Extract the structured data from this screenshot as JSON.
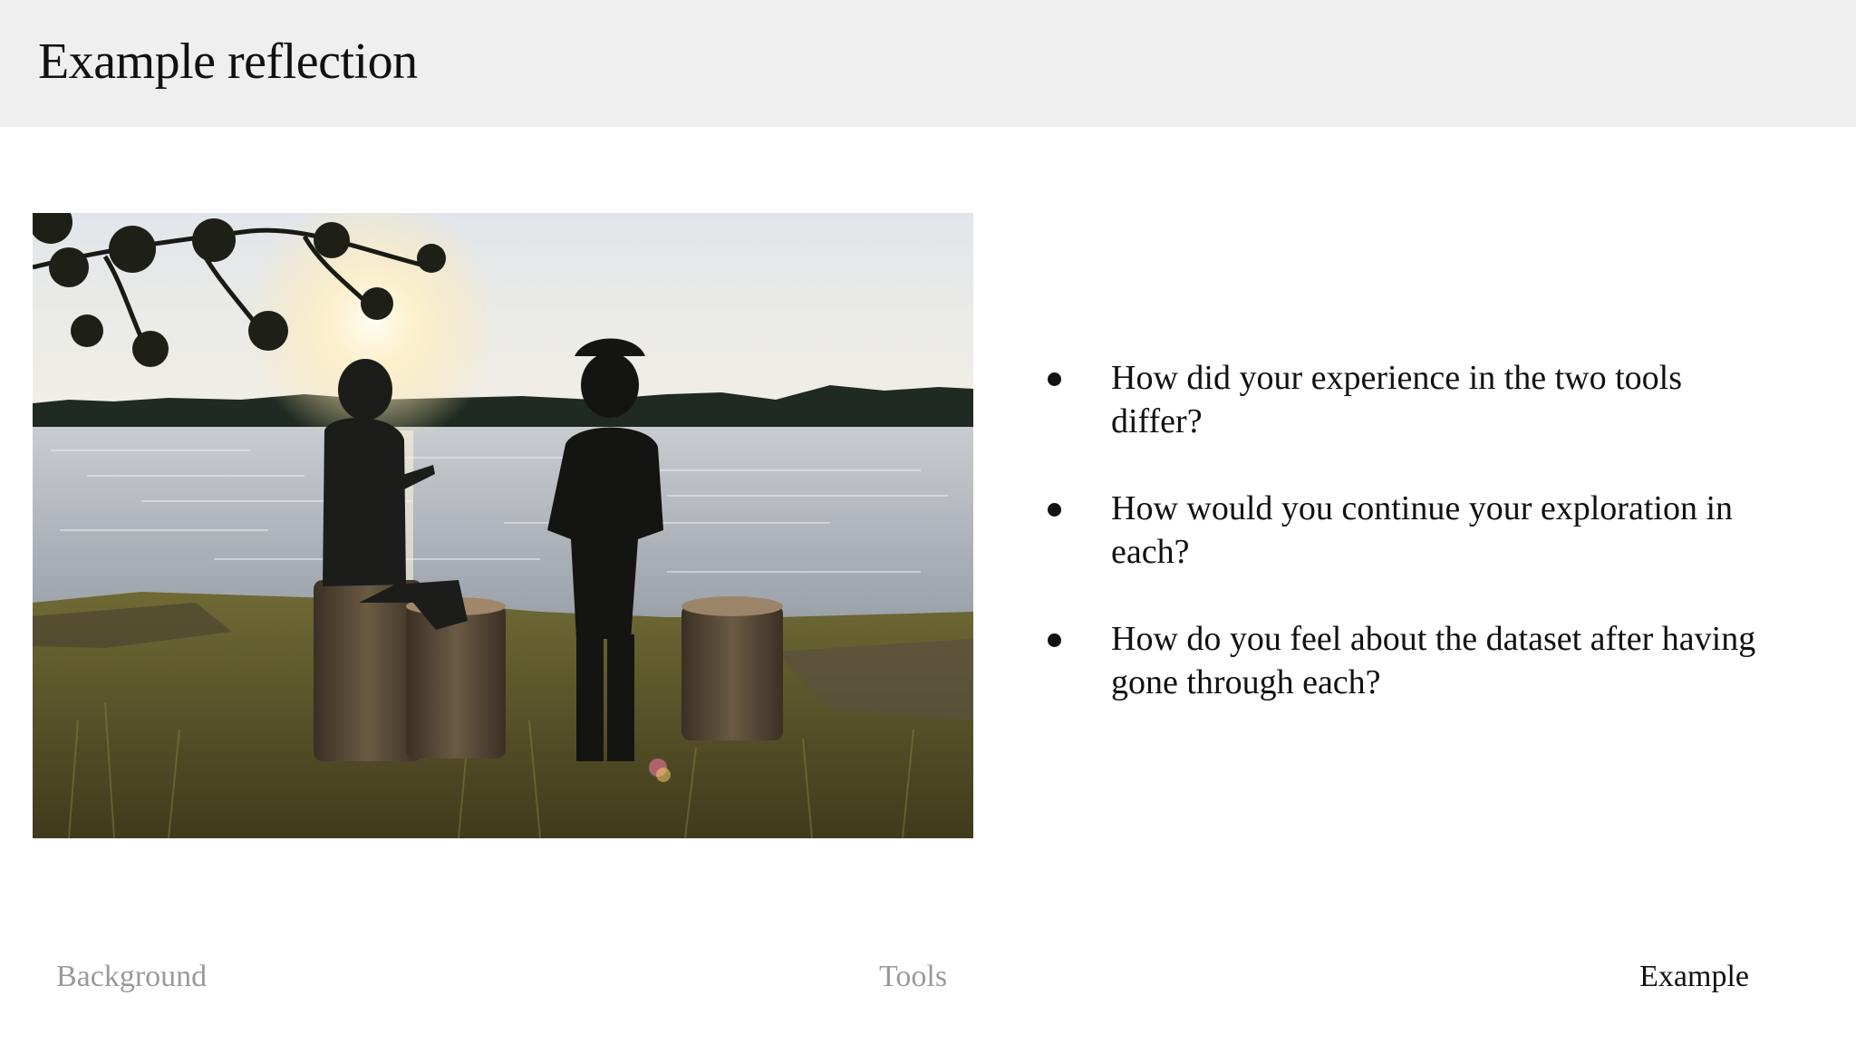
{
  "header": {
    "title": "Example reflection"
  },
  "image": {
    "subject": "two-people-by-lake-photo"
  },
  "bullets": [
    {
      "text": "How did your experience in the two tools differ?"
    },
    {
      "text": "How would you continue your exploration in each?"
    },
    {
      "text": "How do you feel about the dataset after having gone through each?"
    }
  ],
  "nav": {
    "items": [
      {
        "label": "Background",
        "active": false
      },
      {
        "label": "Tools",
        "active": false
      },
      {
        "label": "Example",
        "active": true
      }
    ]
  },
  "colors": {
    "header_bg": "#efefef",
    "text": "#111111",
    "nav_muted": "#9a9a9a"
  }
}
